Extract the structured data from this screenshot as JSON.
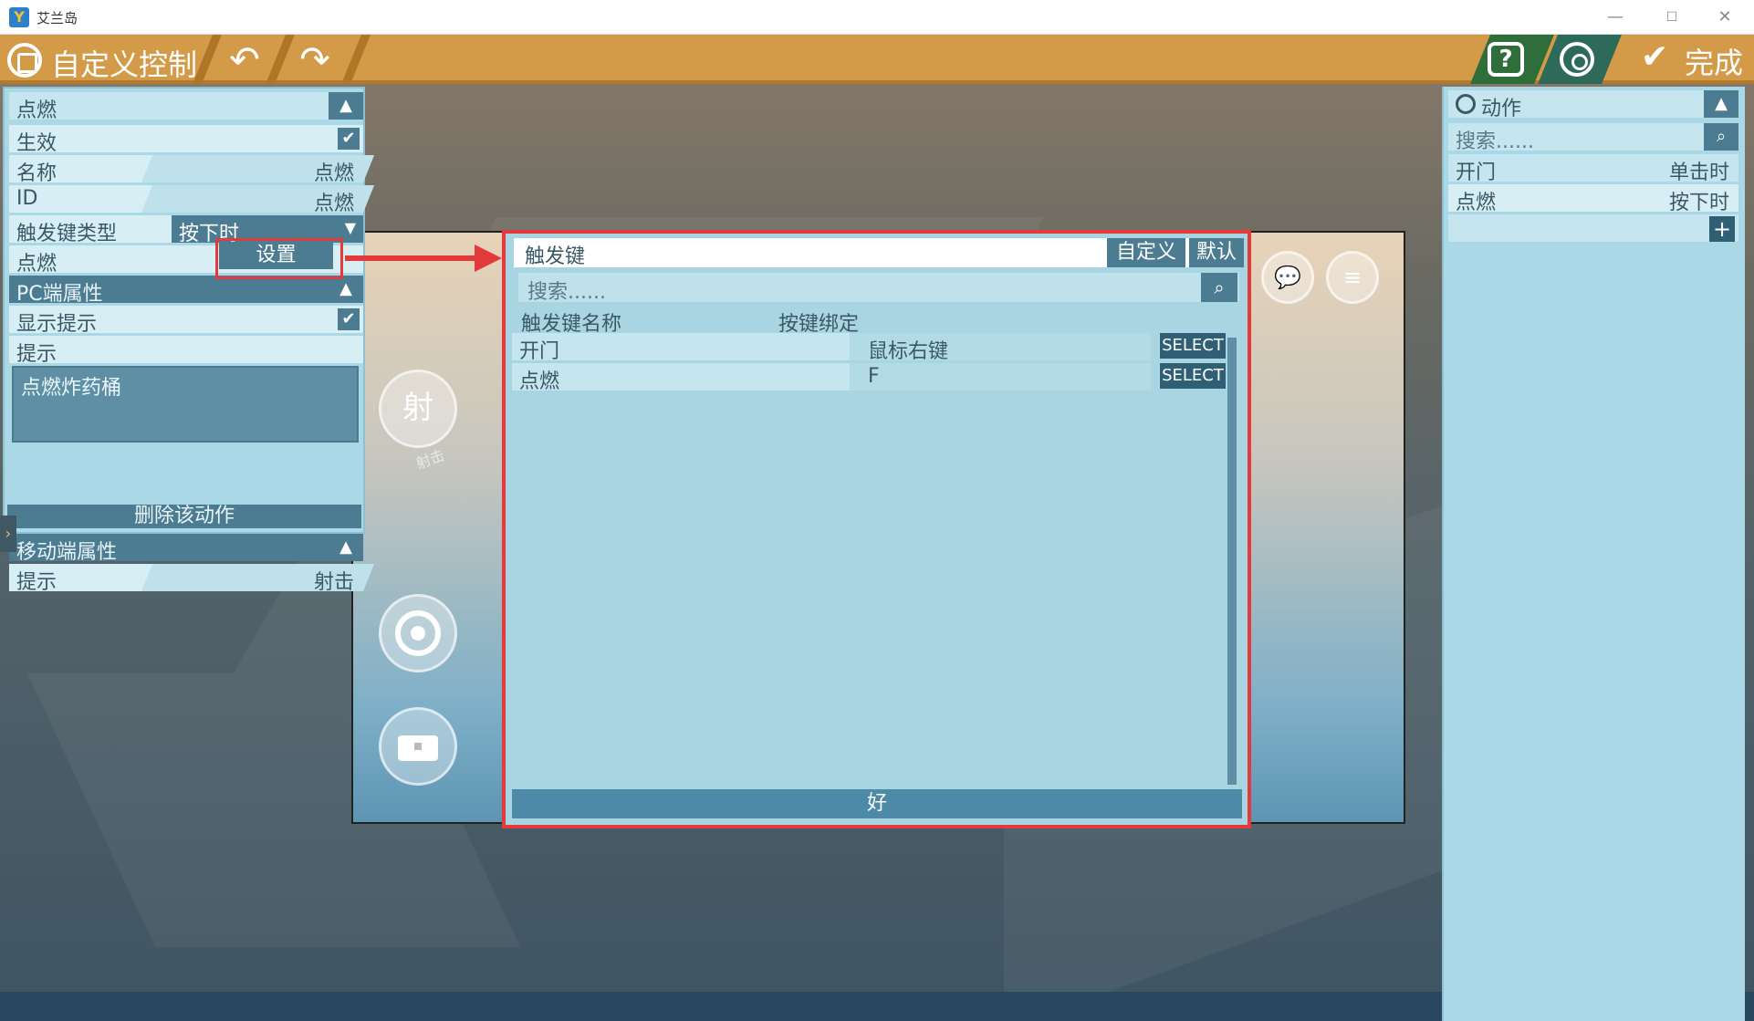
{
  "window": {
    "title": "艾兰岛",
    "logo": "Y",
    "minimize": "—",
    "maximize": "☐",
    "close": "✕"
  },
  "toolbar": {
    "title": "自定义控制",
    "undo_icon": "↶",
    "redo_icon": "↷",
    "help_icon": "?",
    "done_label": "完成",
    "done_icon": "✔"
  },
  "left_panel": {
    "header": "点燃",
    "effective_label": "生效",
    "effective_checked": "✔",
    "name_label": "名称",
    "name_value": "点燃",
    "id_label": "ID",
    "id_value": "点燃",
    "trigger_type_label": "触发键类型",
    "trigger_type_value": "按下时",
    "trigger_label": "点燃",
    "set_button": "设置",
    "pc_header": "PC端属性",
    "show_hint_label": "显示提示",
    "show_hint_checked": "✔",
    "hint_label": "提示",
    "hint_text": "点燃炸药桶",
    "mobile_header": "移动端属性",
    "mobile_hint_label": "提示",
    "mobile_hint_value": "射击",
    "delete_button": "删除该动作",
    "collapse_icon": "▲",
    "dropdown_icon": "▼",
    "side_tab": "›"
  },
  "preview": {
    "shoot_button": "射",
    "shoot_caption": "射击",
    "chat_icon": "💬",
    "menu_icon": "≡"
  },
  "dialog": {
    "title": "触发键",
    "tab_custom": "自定义",
    "tab_default": "默认",
    "search_placeholder": "搜索......",
    "search_icon": "⌕",
    "col_name": "触发键名称",
    "col_binding": "按键绑定",
    "rows": [
      {
        "name": "开门",
        "binding": "鼠标右键",
        "select": "SELECT"
      },
      {
        "name": "点燃",
        "binding": "F",
        "select": "SELECT"
      }
    ],
    "ok_button": "好"
  },
  "right_panel": {
    "header": "动作",
    "search_placeholder": "搜索......",
    "search_icon": "⌕",
    "actions": [
      {
        "name": "开门",
        "trigger": "单击时"
      },
      {
        "name": "点燃",
        "trigger": "按下时"
      }
    ],
    "add_icon": "+"
  }
}
